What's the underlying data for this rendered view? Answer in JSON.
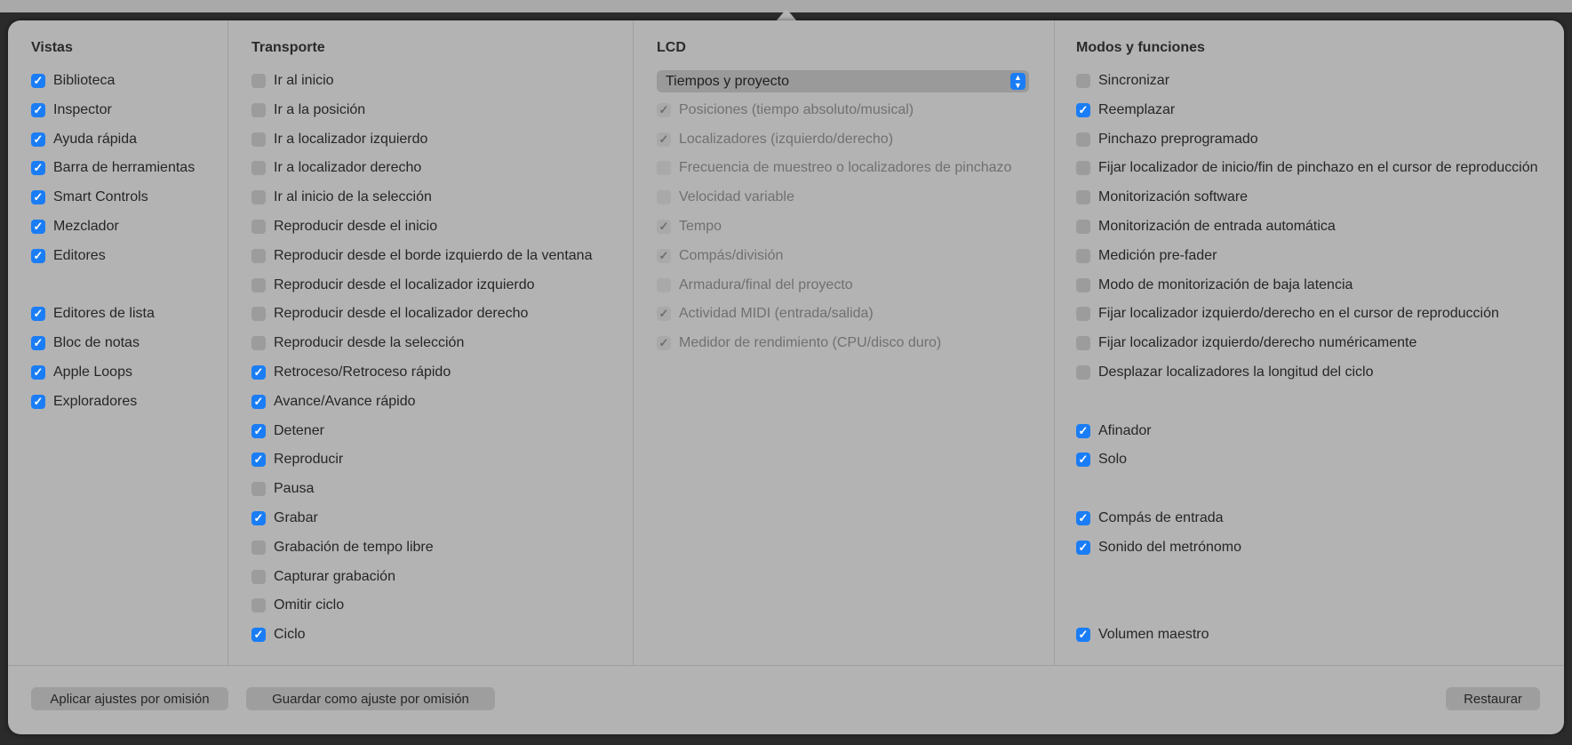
{
  "columns": {
    "vistas": {
      "title": "Vistas",
      "items": [
        {
          "label": "Biblioteca",
          "checked": true
        },
        {
          "label": "Inspector",
          "checked": true
        },
        {
          "label": "Ayuda rápida",
          "checked": true
        },
        {
          "label": "Barra de herramientas",
          "checked": true
        },
        {
          "label": "Smart Controls",
          "checked": true
        },
        {
          "label": "Mezclador",
          "checked": true
        },
        {
          "label": "Editores",
          "checked": true
        },
        {
          "label": "Editores de lista",
          "checked": true
        },
        {
          "label": "Bloc de notas",
          "checked": true
        },
        {
          "label": "Apple Loops",
          "checked": true
        },
        {
          "label": "Exploradores",
          "checked": true
        }
      ]
    },
    "transporte": {
      "title": "Transporte",
      "items": [
        {
          "label": "Ir al inicio",
          "checked": false
        },
        {
          "label": "Ir a la posición",
          "checked": false
        },
        {
          "label": "Ir a localizador izquierdo",
          "checked": false
        },
        {
          "label": "Ir a localizador derecho",
          "checked": false
        },
        {
          "label": "Ir al inicio de la selección",
          "checked": false
        },
        {
          "label": "Reproducir desde el inicio",
          "checked": false
        },
        {
          "label": "Reproducir desde el borde izquierdo de la ventana",
          "checked": false
        },
        {
          "label": "Reproducir desde el localizador izquierdo",
          "checked": false
        },
        {
          "label": "Reproducir desde el localizador derecho",
          "checked": false
        },
        {
          "label": "Reproducir desde la selección",
          "checked": false
        },
        {
          "label": "Retroceso/Retroceso rápido",
          "checked": true
        },
        {
          "label": "Avance/Avance rápido",
          "checked": true
        },
        {
          "label": "Detener",
          "checked": true
        },
        {
          "label": "Reproducir",
          "checked": true
        },
        {
          "label": "Pausa",
          "checked": false
        },
        {
          "label": "Grabar",
          "checked": true
        },
        {
          "label": "Grabación de tempo libre",
          "checked": false
        },
        {
          "label": "Capturar grabación",
          "checked": false
        },
        {
          "label": "Omitir ciclo",
          "checked": false
        },
        {
          "label": "Ciclo",
          "checked": true
        }
      ]
    },
    "lcd": {
      "title": "LCD",
      "mode_select": "Tiempos y proyecto",
      "disabled": true,
      "items": [
        {
          "label": "Posiciones (tiempo absoluto/musical)",
          "checked": true
        },
        {
          "label": "Localizadores (izquierdo/derecho)",
          "checked": true
        },
        {
          "label": "Frecuencia de muestreo o localizadores de pinchazo",
          "checked": false
        },
        {
          "label": "Velocidad variable",
          "checked": false
        },
        {
          "label": "Tempo",
          "checked": true
        },
        {
          "label": "Compás/división",
          "checked": true
        },
        {
          "label": "Armadura/final del proyecto",
          "checked": false
        },
        {
          "label": "Actividad MIDI (entrada/salida)",
          "checked": true
        },
        {
          "label": "Medidor de rendimiento (CPU/disco duro)",
          "checked": true
        }
      ]
    },
    "modos": {
      "title": "Modos y funciones",
      "items": [
        {
          "label": "Sincronizar",
          "checked": false
        },
        {
          "label": "Reemplazar",
          "checked": true
        },
        {
          "label": "Pinchazo preprogramado",
          "checked": false
        },
        {
          "label": "Fijar localizador de inicio/fin de pinchazo en el cursor de reproducción",
          "checked": false
        },
        {
          "label": "Monitorización software",
          "checked": false
        },
        {
          "label": "Monitorización de entrada automática",
          "checked": false
        },
        {
          "label": "Medición pre-fader",
          "checked": false
        },
        {
          "label": "Modo de monitorización de baja latencia",
          "checked": false
        },
        {
          "label": "Fijar localizador izquierdo/derecho en el cursor de reproducción",
          "checked": false
        },
        {
          "label": "Fijar localizador izquierdo/derecho numéricamente",
          "checked": false
        },
        {
          "label": "Desplazar localizadores la longitud del ciclo",
          "checked": false
        },
        {
          "label": "Afinador",
          "checked": true
        },
        {
          "label": "Solo",
          "checked": true
        },
        {
          "label": "Compás de entrada",
          "checked": true
        },
        {
          "label": "Sonido del metrónomo",
          "checked": true
        },
        {
          "label": "Volumen maestro",
          "checked": true
        }
      ]
    }
  },
  "footer": {
    "apply_defaults": "Aplicar ajustes por omisión",
    "save_default": "Guardar como ajuste por omisión",
    "restore": "Restaurar"
  },
  "colors": {
    "accent": "#1a7df5",
    "panel": "#b3b3b3"
  }
}
